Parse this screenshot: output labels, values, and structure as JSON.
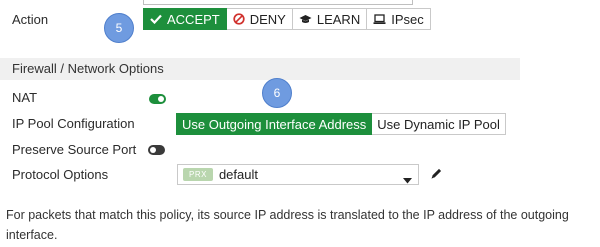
{
  "action": {
    "label": "Action",
    "options": [
      {
        "label": "ACCEPT",
        "icon": "check-icon",
        "active": true
      },
      {
        "label": "DENY",
        "icon": "deny-icon",
        "active": false
      },
      {
        "label": "LEARN",
        "icon": "graduation-cap-icon",
        "active": false
      },
      {
        "label": "IPsec",
        "icon": "laptop-icon",
        "active": false
      }
    ]
  },
  "callouts": {
    "first": "5",
    "second": "6"
  },
  "section": {
    "title": "Firewall / Network Options"
  },
  "nat": {
    "label": "NAT",
    "enabled": true
  },
  "ip_pool": {
    "label": "IP Pool Configuration",
    "options": [
      {
        "label": "Use Outgoing Interface Address",
        "active": true
      },
      {
        "label": "Use Dynamic IP Pool",
        "active": false
      }
    ]
  },
  "preserve_source_port": {
    "label": "Preserve Source Port",
    "enabled": false
  },
  "protocol_options": {
    "label": "Protocol Options",
    "badge": "PRX",
    "value": "default"
  },
  "note": "For packets that match this policy, its source IP address is translated to the IP address of the outgoing interface.",
  "colors": {
    "accent_green": "#1d8f3c",
    "callout_blue": "#6f9be0"
  }
}
